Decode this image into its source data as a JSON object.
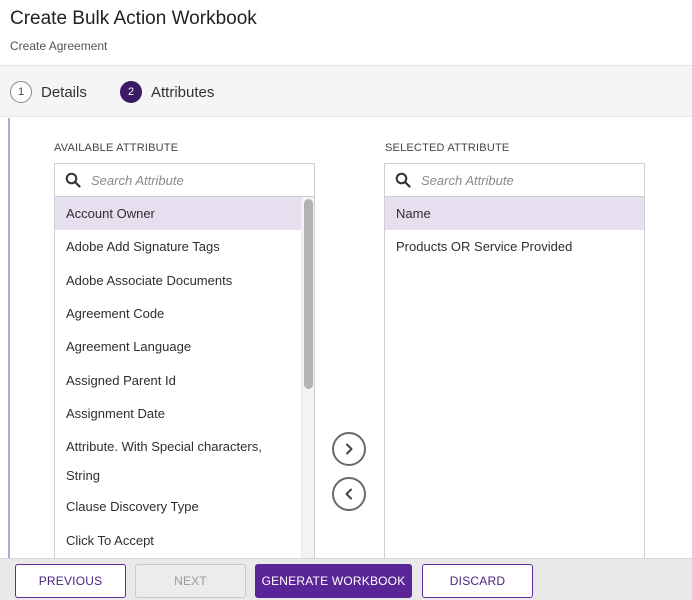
{
  "header": {
    "title": "Create Bulk Action Workbook",
    "subtitle": "Create Agreement"
  },
  "steps": [
    {
      "number": "1",
      "label": "Details",
      "active": false
    },
    {
      "number": "2",
      "label": "Attributes",
      "active": true
    }
  ],
  "available": {
    "title": "AVAILABLE ATTRIBUTE",
    "search_placeholder": "Search Attribute",
    "items": [
      "Account Owner",
      "Adobe Add Signature Tags",
      "Adobe Associate Documents",
      "Agreement Code",
      "Agreement Language",
      "Assigned Parent Id",
      "Assignment Date",
      "Attribute. With Special characters, String",
      "Clause Discovery Type",
      "Click To Accept"
    ],
    "selected_item": "Account Owner"
  },
  "selected": {
    "title": "SELECTED ATTRIBUTE",
    "search_placeholder": "Search Attribute",
    "items": [
      "Name",
      "Products OR Service Provided"
    ],
    "selected_item": "Name"
  },
  "footer": {
    "previous": "PREVIOUS",
    "next": "NEXT",
    "generate": "GENERATE WORKBOOK",
    "discard": "DISCARD"
  },
  "icons": {
    "move_right": "chevron-right-circle-icon",
    "move_left": "chevron-left-circle-icon",
    "search": "search-icon"
  },
  "colors": {
    "accent": "#5a2596",
    "step_active": "#3b1a66",
    "selection": "#e6dff0"
  }
}
